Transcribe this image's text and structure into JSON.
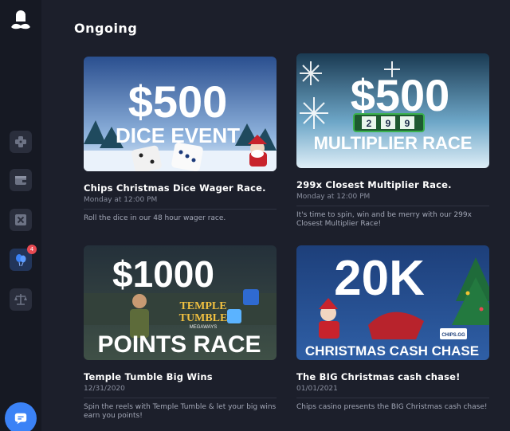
{
  "sidebar": {
    "logo": "chef-mustache-logo",
    "items": [
      {
        "name": "games-icon"
      },
      {
        "name": "wallet-icon"
      },
      {
        "name": "close-box-icon"
      },
      {
        "name": "balloons-icon",
        "badge": "4"
      },
      {
        "name": "scales-icon"
      }
    ],
    "chat_icon": "chat-icon"
  },
  "page": {
    "heading": "Ongoing"
  },
  "cards": [
    {
      "banner_big": "$500",
      "banner_sub": "DICE EVENT",
      "title": "Chips Christmas Dice Wager Race.",
      "date": "Monday at 12:00 PM",
      "desc": "Roll the dice in our 48 hour wager race."
    },
    {
      "banner_big": "$500",
      "banner_digits": [
        "2",
        "9",
        "9"
      ],
      "banner_sub": "MULTIPLIER RACE",
      "title": "299x Closest Multiplier Race.",
      "date": "Monday at 12:00 PM",
      "desc": "It's time to spin, win and be merry with our 299x Closest Multiplier Race!"
    },
    {
      "banner_big": "$1000",
      "banner_mid_1": "TEMPLE",
      "banner_mid_2": "TUMBLE",
      "banner_mid_3": "MEGAWAYS",
      "banner_sub": "POINTS RACE",
      "title": "Temple Tumble Big Wins",
      "date": "12/31/2020",
      "desc": "Spin the reels with Temple Tumble & let your big wins earn you points!"
    },
    {
      "banner_big": "20K",
      "banner_brand": "CHIPS.GG",
      "banner_sub": "CHRISTMAS CASH CHASE",
      "title": "The BIG Christmas cash chase!",
      "date": "01/01/2021",
      "desc": "Chips casino presents the BIG Christmas cash chase!"
    }
  ],
  "colors": {
    "sidebar_bg": "#161923",
    "main_bg": "#1c1f2b",
    "accent": "#3b82f6",
    "badge": "#e84a52"
  }
}
